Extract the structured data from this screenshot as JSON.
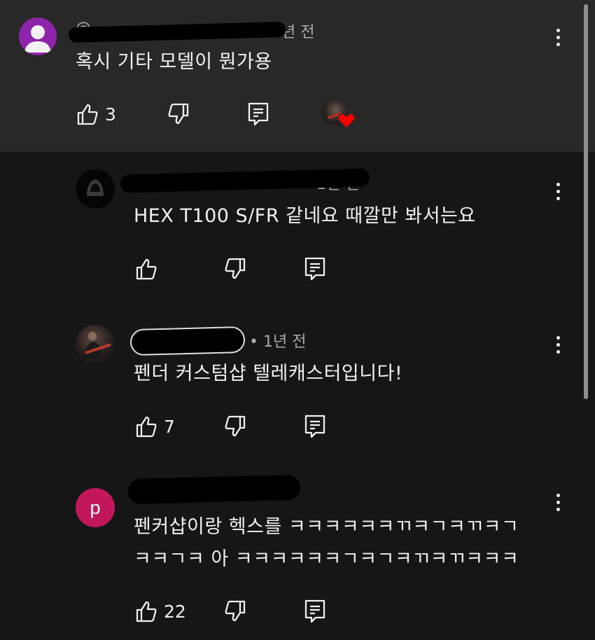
{
  "comments": [
    {
      "handle": "@",
      "time": "1년 전",
      "text": "혹시 기타 모델이 뭔가용",
      "likes": "3",
      "avatar_letter": "person-icon",
      "avatar_color": "#8e24aa"
    },
    {
      "handle": "",
      "time": "1년 전",
      "text": "HEX T100 S/FR 같네요 때깔만 봐서는요",
      "likes": "",
      "avatar_label": "unknown"
    },
    {
      "handle": "",
      "time": "• 1년 전",
      "text": "펜더 커스텀샵 텔레캐스터입니다!",
      "likes": "7"
    },
    {
      "handle": "@",
      "time": "",
      "text_line1": "펜커샵이랑 헥스를 ㅋㅋㅋㅋㅋㅋㄲㅋㄱㅋㄲㅋㄱ",
      "text_line2": "ㅋㅋㄱㅋ 아 ㅋㅋㅋㅋㅋㅋㄱㅋㄱㅋㄲㅋㄲㅋㅋㅋ",
      "likes": "22",
      "avatar_letter": "p",
      "avatar_color": "#c2185b"
    }
  ],
  "colors": {
    "background": "#161616",
    "highlight": "#282828",
    "heart": "#ff0000"
  }
}
